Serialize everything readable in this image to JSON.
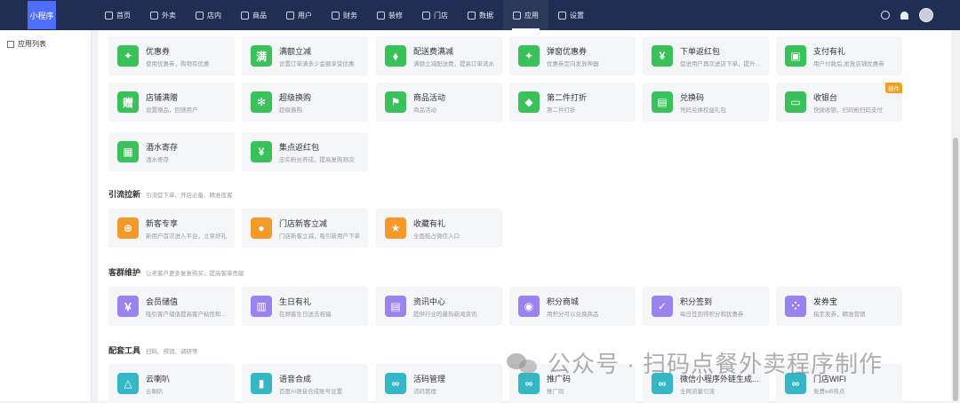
{
  "app": {
    "logo_text": "小程序"
  },
  "nav": [
    {
      "label": "首页",
      "icon": "home-icon"
    },
    {
      "label": "外卖",
      "icon": "takeout-icon"
    },
    {
      "label": "店内",
      "icon": "store-icon"
    },
    {
      "label": "商品",
      "icon": "goods-icon"
    },
    {
      "label": "用户",
      "icon": "user-icon"
    },
    {
      "label": "财务",
      "icon": "finance-icon"
    },
    {
      "label": "装修",
      "icon": "decorate-icon"
    },
    {
      "label": "门店",
      "icon": "shop-icon"
    },
    {
      "label": "数据",
      "icon": "chart-icon"
    },
    {
      "label": "应用",
      "icon": "apps-icon",
      "active": true
    },
    {
      "label": "设置",
      "icon": "settings-icon"
    }
  ],
  "sidebar": {
    "items": [
      {
        "label": "应用列表",
        "icon": "grid-icon"
      }
    ]
  },
  "sections": {
    "traffic": {
      "title": "引流拉新",
      "desc": "引流促下单、开店必备、精准揽客"
    },
    "retention": {
      "title": "客群维护",
      "desc": "让老客户更多复复购买、提高客单贡献"
    },
    "tools": {
      "title": "配套工具",
      "desc": "扫码、核销、调研等"
    }
  },
  "cards": {
    "marketing": [
      {
        "title": "优惠券",
        "desc": "使用优惠券，购物有优惠",
        "icon": "coupon-icon",
        "color": "#3ac25a"
      },
      {
        "title": "满额立减",
        "desc": "设置订单满多少金额享受优惠",
        "icon": "full-reduce-icon",
        "color": "#3ac25a"
      },
      {
        "title": "配送费满减",
        "desc": "满额立减配送费，提高订单流水",
        "icon": "delivery-fee-icon",
        "color": "#3ac25a"
      },
      {
        "title": "弹窗优惠券",
        "desc": "优惠券定向发放神器",
        "icon": "popup-coupon-icon",
        "color": "#3ac25a"
      },
      {
        "title": "下单返红包",
        "desc": "促进用户再次进店下单，提升复购",
        "icon": "red-packet-icon",
        "color": "#3ac25a"
      },
      {
        "title": "支付有礼",
        "desc": "用户付款后,发放店铺优惠券",
        "icon": "gift-bag-icon",
        "color": "#3ac25a"
      },
      {
        "title": "店铺满赠",
        "desc": "设置赠品，回馈用户",
        "icon": "gift-text-icon",
        "color": "#3ac25a"
      },
      {
        "title": "超级换购",
        "desc": "超级换购",
        "icon": "swap-icon",
        "color": "#3ac25a"
      },
      {
        "title": "商品活动",
        "desc": "商品活动",
        "icon": "flag-icon",
        "color": "#3ac25a"
      },
      {
        "title": "第二件打折",
        "desc": "第二件打折",
        "icon": "discount-tag-icon",
        "color": "#3ac25a"
      },
      {
        "title": "兑换码",
        "desc": "凭码兑换权益礼包",
        "icon": "redeem-icon",
        "color": "#3ac25a"
      },
      {
        "title": "收银台",
        "desc": "快捷收银，扫码枪扫码支付",
        "icon": "cashier-icon",
        "color": "#3ac25a",
        "badge": "插件"
      },
      {
        "title": "酒水寄存",
        "desc": "酒水寄存",
        "icon": "storage-icon",
        "color": "#3ac25a"
      },
      {
        "title": "集点返红包",
        "desc": "忠实粉丝养成，提高复购频次",
        "icon": "points-packet-icon",
        "color": "#3ac25a"
      }
    ],
    "traffic": [
      {
        "title": "新客专享",
        "desc": "新用户首次进入平台，立享好礼",
        "icon": "new-customer-icon",
        "color": "#f39a2a"
      },
      {
        "title": "门店新客立减",
        "desc": "门店新客立减，吸引新用户下单",
        "icon": "store-new-icon",
        "color": "#f39a2a"
      },
      {
        "title": "收藏有礼",
        "desc": "全面拓占微信入口",
        "icon": "star-icon",
        "color": "#f39a2a"
      }
    ],
    "retention": [
      {
        "title": "会员储值",
        "desc": "吸引客户储值提高客户粘性和消费",
        "icon": "wallet-icon",
        "color": "#9a82ef"
      },
      {
        "title": "生日有礼",
        "desc": "在顾客生日送去祝福",
        "icon": "cake-icon",
        "color": "#9a82ef"
      },
      {
        "title": "资讯中心",
        "desc": "提供行业的最热新闻资讯",
        "icon": "news-icon",
        "color": "#9a82ef"
      },
      {
        "title": "积分商城",
        "desc": "用积分可以兑换商品",
        "icon": "points-mall-icon",
        "color": "#9a82ef"
      },
      {
        "title": "积分签到",
        "desc": "每日签到得积分和优惠券",
        "icon": "calendar-check-icon",
        "color": "#9a82ef"
      },
      {
        "title": "发券宝",
        "desc": "指定发券，精准营销",
        "icon": "apps-grid-icon",
        "color": "#9a82ef"
      }
    ],
    "tools": [
      {
        "title": "云喇叭",
        "desc": "云喇叭",
        "icon": "bell-icon",
        "color": "#35b7c6"
      },
      {
        "title": "语音合成",
        "desc": "百度AI语音合成账号设置",
        "icon": "mic-icon",
        "color": "#35b7c6"
      },
      {
        "title": "活码管理",
        "desc": "活码管理",
        "icon": "link-icon",
        "color": "#35b7c6"
      },
      {
        "title": "推广码",
        "desc": "推广码",
        "icon": "promo-code-icon",
        "color": "#35b7c6"
      },
      {
        "title": "微信小程序外链生成...",
        "desc": "全网流量引流",
        "icon": "mini-link-icon",
        "color": "#35b7c6"
      },
      {
        "title": "门店WIFI",
        "desc": "免费wifi热点",
        "icon": "wifi-link-icon",
        "color": "#35b7c6"
      }
    ]
  },
  "glyphs": {
    "coupon-icon": "✦",
    "full-reduce-icon": "满",
    "delivery-fee-icon": "⬧",
    "popup-coupon-icon": "✦",
    "red-packet-icon": "¥",
    "gift-bag-icon": "▣",
    "gift-text-icon": "赠",
    "swap-icon": "✻",
    "flag-icon": "⚑",
    "discount-tag-icon": "◆",
    "redeem-icon": "▤",
    "cashier-icon": "▭",
    "storage-icon": "▦",
    "points-packet-icon": "¥",
    "new-customer-icon": "⊕",
    "store-new-icon": "●",
    "star-icon": "★",
    "wallet-icon": "￥",
    "cake-icon": "▥",
    "news-icon": "▤",
    "points-mall-icon": "◉",
    "calendar-check-icon": "✓",
    "apps-grid-icon": "⁘",
    "bell-icon": "△",
    "mic-icon": "▮",
    "link-icon": "∞",
    "promo-code-icon": "∞",
    "mini-link-icon": "∞",
    "wifi-link-icon": "∞"
  },
  "watermark": {
    "text": "公众号 · 扫码点餐外卖程序制作"
  }
}
